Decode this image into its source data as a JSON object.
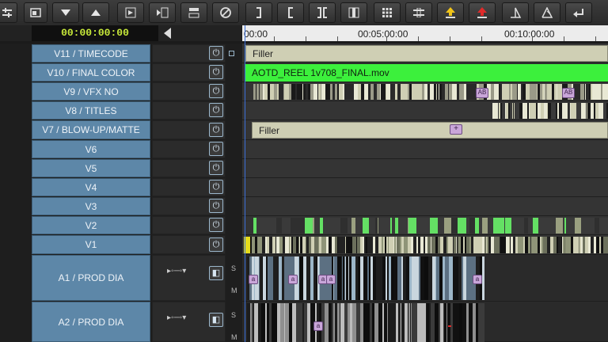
{
  "timecode": "00:00:00:00",
  "ruler": {
    "labels": [
      "00:00",
      "00:05:00:00",
      "00:10:00:00"
    ]
  },
  "tracks": [
    {
      "label": "V11 / TIMECODE"
    },
    {
      "label": "V10 / FINAL COLOR"
    },
    {
      "label": "V9 / VFX NO"
    },
    {
      "label": "V8 / TITLES"
    },
    {
      "label": "V7 / BLOW-UP/MATTE"
    },
    {
      "label": "V6"
    },
    {
      "label": "V5"
    },
    {
      "label": "V4"
    },
    {
      "label": "V3"
    },
    {
      "label": "V2"
    },
    {
      "label": "V1"
    },
    {
      "label": "A1 / PROD DIA"
    },
    {
      "label": "A2 / PROD DIA"
    }
  ],
  "clips": {
    "v11_filler": "Filler",
    "v10_clip": "AOTD_REEL 1v708_FINAL.mov",
    "v7_filler": "Filler"
  },
  "toolbar_icons": [
    "settings-icon",
    "window-icon",
    "down-triangle-icon",
    "up-triangle-icon",
    "extract-icon",
    "insert-icon",
    "overwrite-icon",
    "clear-icon",
    "mark-out-icon",
    "mark-in-icon",
    "split-icon",
    "lift-icon",
    "grid-icon",
    "segment-icon",
    "lift-yellow-icon",
    "lift-red-icon",
    "trim-icon",
    "trim-alt-icon",
    "return-icon"
  ],
  "colors": {
    "track_label": "#5d87a8",
    "filler": "#cfcfb4",
    "final_color_clip": "#3cf03c",
    "timecode_text": "#c7e93a",
    "playhead": "#3a6fd8"
  }
}
